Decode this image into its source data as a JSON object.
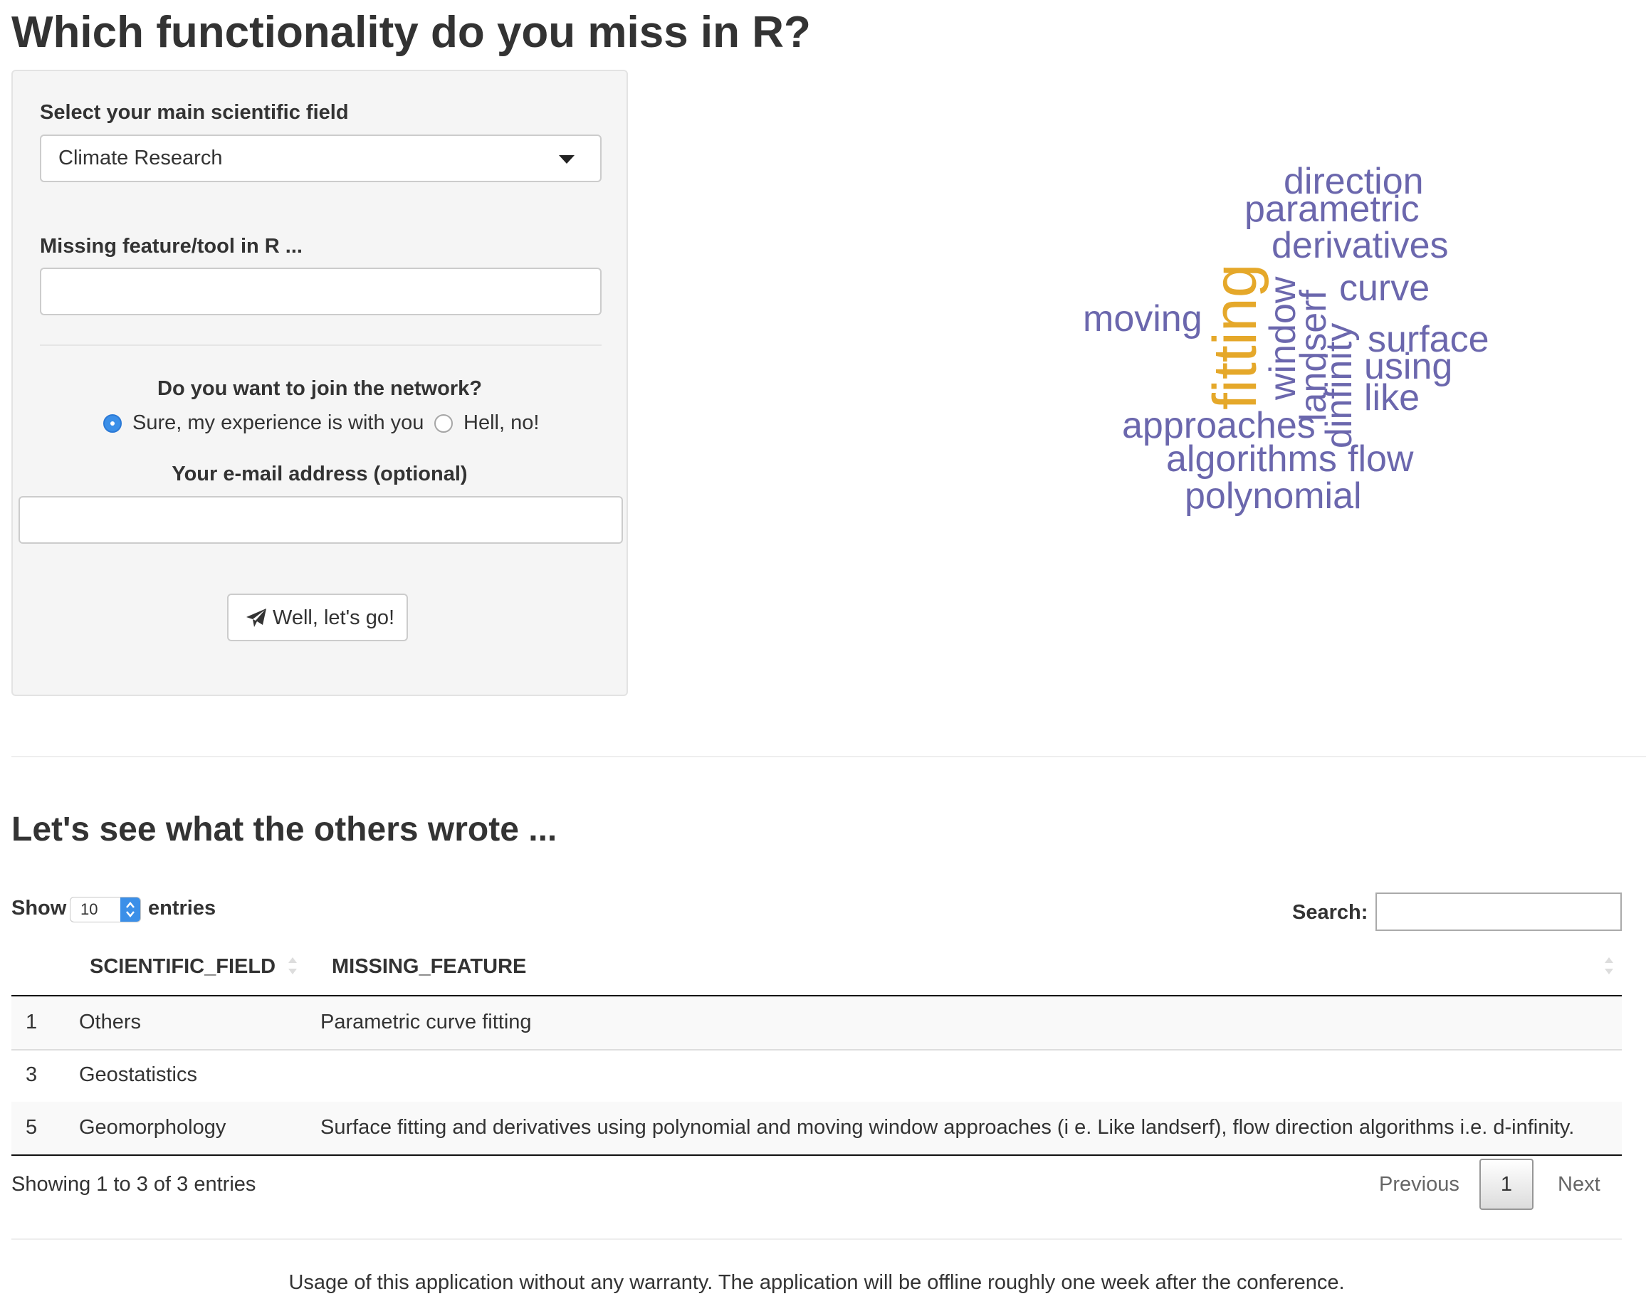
{
  "page": {
    "title": "Which functionality do you miss in R?"
  },
  "form": {
    "field_label": "Select your main scientific field",
    "field_value": "Climate Research",
    "feature_label": "Missing feature/tool in R ...",
    "feature_value": "",
    "network_question": "Do you want to join the network?",
    "radio_options": [
      {
        "label": "Sure, my experience is with you",
        "selected": true
      },
      {
        "label": "Hell, no!",
        "selected": false
      }
    ],
    "email_label": "Your e-mail address (optional)",
    "email_value": "",
    "submit_label": "Well, let's go!",
    "submit_icon": "paper-plane-icon"
  },
  "word_cloud": {
    "words": [
      {
        "text": "direction",
        "color": "#6b67ad"
      },
      {
        "text": "parametric",
        "color": "#6b67ad"
      },
      {
        "text": "derivatives",
        "color": "#6b67ad"
      },
      {
        "text": "fitting",
        "color": "#e5a82a"
      },
      {
        "text": "curve",
        "color": "#6b67ad"
      },
      {
        "text": "moving",
        "color": "#6b67ad"
      },
      {
        "text": "window",
        "color": "#6b67ad"
      },
      {
        "text": "landserf",
        "color": "#6b67ad"
      },
      {
        "text": "dinfinity",
        "color": "#6b67ad"
      },
      {
        "text": "surface",
        "color": "#6b67ad"
      },
      {
        "text": "using",
        "color": "#6b67ad"
      },
      {
        "text": "like",
        "color": "#6b67ad"
      },
      {
        "text": "approaches",
        "color": "#6b67ad"
      },
      {
        "text": "algorithms",
        "color": "#6b67ad"
      },
      {
        "text": "flow",
        "color": "#6b67ad"
      },
      {
        "text": "polynomial",
        "color": "#6b67ad"
      }
    ]
  },
  "results": {
    "heading": "Let's see what the others wrote ...",
    "length_prefix": "Show",
    "length_value": "10",
    "length_suffix": "entries",
    "search_label": "Search:",
    "search_value": "",
    "columns": [
      "",
      "SCIENTIFIC_FIELD",
      "MISSING_FEATURE"
    ],
    "rows": [
      {
        "id": "1",
        "field": "Others",
        "feature": "Parametric curve fitting"
      },
      {
        "id": "3",
        "field": "Geostatistics",
        "feature": ""
      },
      {
        "id": "5",
        "field": "Geomorphology",
        "feature": "Surface fitting and derivatives using polynomial and moving window approaches (i e. Like landserf), flow direction algorithms i.e. d-infinity."
      }
    ],
    "info": "Showing 1 to 3 of 3 entries",
    "pagination": {
      "previous": "Previous",
      "current": "1",
      "next": "Next"
    }
  },
  "footer": {
    "note": "Usage of this application without any warranty. The application will be offline roughly one week after the conference."
  },
  "colors": {
    "accent": "#3b8fe8",
    "cloud_primary": "#6b67ad",
    "cloud_highlight": "#e5a82a"
  }
}
